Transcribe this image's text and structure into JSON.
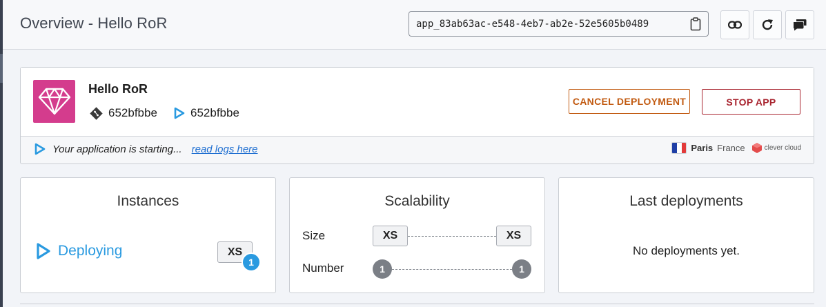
{
  "header": {
    "title": "Overview - Hello RoR",
    "app_id": "app_83ab63ac-e548-4eb7-ab2e-52e5605b0489"
  },
  "app": {
    "name": "Hello RoR",
    "commit_current": "652bfbbe",
    "commit_deploying": "652bfbbe",
    "cancel_label": "CANCEL DEPLOYMENT",
    "stop_label": "STOP APP",
    "status_text": "Your application is starting...",
    "logs_link": "read logs here",
    "zone_city": "Paris",
    "zone_country": "France",
    "provider": "clever cloud",
    "logo_color": "#d43c8d"
  },
  "instances": {
    "title": "Instances",
    "state": "Deploying",
    "size": "XS",
    "count": "1"
  },
  "scalability": {
    "title": "Scalability",
    "size_label": "Size",
    "size_min": "XS",
    "size_max": "XS",
    "number_label": "Number",
    "number_min": "1",
    "number_max": "1"
  },
  "deployments": {
    "title": "Last deployments",
    "empty": "No deployments yet."
  },
  "colors": {
    "accent_blue": "#2a9ae0",
    "cancel_orange": "#c25b12",
    "stop_red": "#a8232e"
  }
}
